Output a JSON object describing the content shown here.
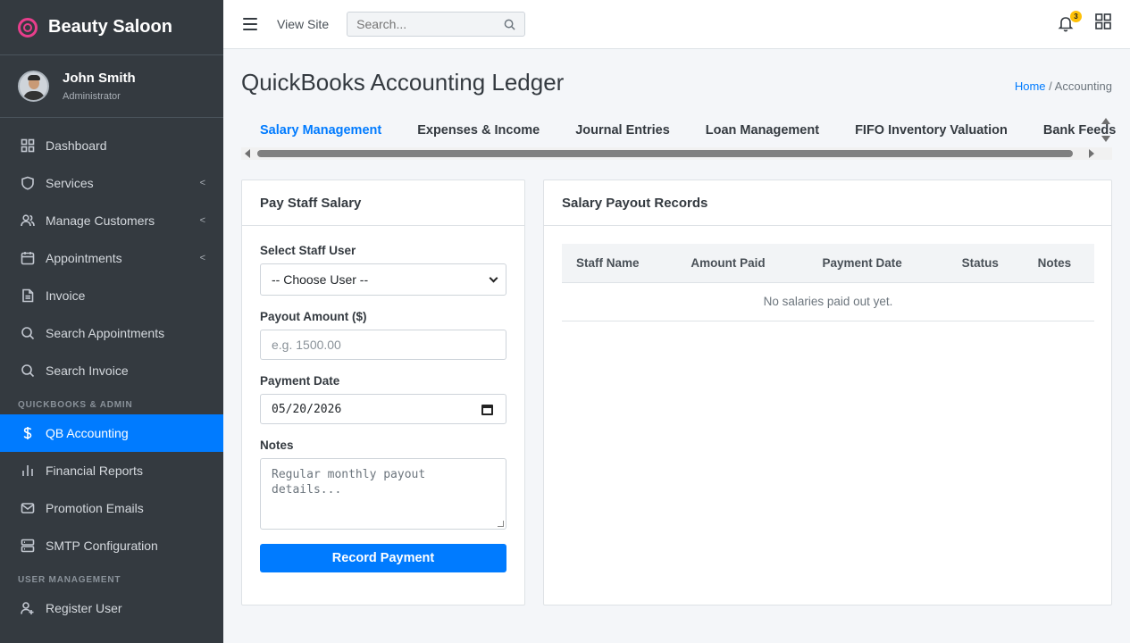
{
  "brand": {
    "name": "Beauty Saloon"
  },
  "user": {
    "name": "John Smith",
    "role": "Administrator"
  },
  "sidebar": {
    "items": [
      {
        "label": "Dashboard"
      },
      {
        "label": "Services",
        "arrow": "<"
      },
      {
        "label": "Manage Customers",
        "arrow": "<"
      },
      {
        "label": "Appointments",
        "arrow": "<"
      },
      {
        "label": "Invoice"
      },
      {
        "label": "Search Appointments"
      },
      {
        "label": "Search Invoice"
      }
    ],
    "header_qb": "QUICKBOOKS & ADMIN",
    "qb_items": [
      {
        "label": "QB Accounting"
      },
      {
        "label": "Financial Reports"
      },
      {
        "label": "Promotion Emails"
      },
      {
        "label": "SMTP Configuration"
      }
    ],
    "header_user": "USER MANAGEMENT",
    "user_items": [
      {
        "label": "Register User"
      }
    ]
  },
  "topbar": {
    "view_site": "View Site",
    "search_placeholder": "Search...",
    "notification_count": "3"
  },
  "page": {
    "title": "QuickBooks Accounting Ledger",
    "breadcrumb_home": "Home",
    "breadcrumb_sep": " / ",
    "breadcrumb_current": "Accounting"
  },
  "tabs": [
    {
      "label": "Salary Management"
    },
    {
      "label": "Expenses & Income"
    },
    {
      "label": "Journal Entries"
    },
    {
      "label": "Loan Management"
    },
    {
      "label": "FIFO Inventory Valuation"
    },
    {
      "label": "Bank Feeds"
    }
  ],
  "pay_form": {
    "title": "Pay Staff Salary",
    "staff_label": "Select Staff User",
    "staff_value": "-- Choose User --",
    "amount_label": "Payout Amount ($)",
    "amount_placeholder": "e.g. 1500.00",
    "date_label": "Payment Date",
    "date_value": "05/20/2026",
    "notes_label": "Notes",
    "notes_placeholder": "Regular monthly payout\ndetails...",
    "submit_label": "Record Payment"
  },
  "records": {
    "title": "Salary Payout Records",
    "columns": [
      "Staff Name",
      "Amount Paid",
      "Payment Date",
      "Status",
      "Notes"
    ],
    "empty_text": "No salaries paid out yet."
  },
  "colors": {
    "accent": "#007bff",
    "sidebar_bg": "#343a40",
    "brand_pink": "#e83e8c",
    "badge": "#ffc107"
  }
}
